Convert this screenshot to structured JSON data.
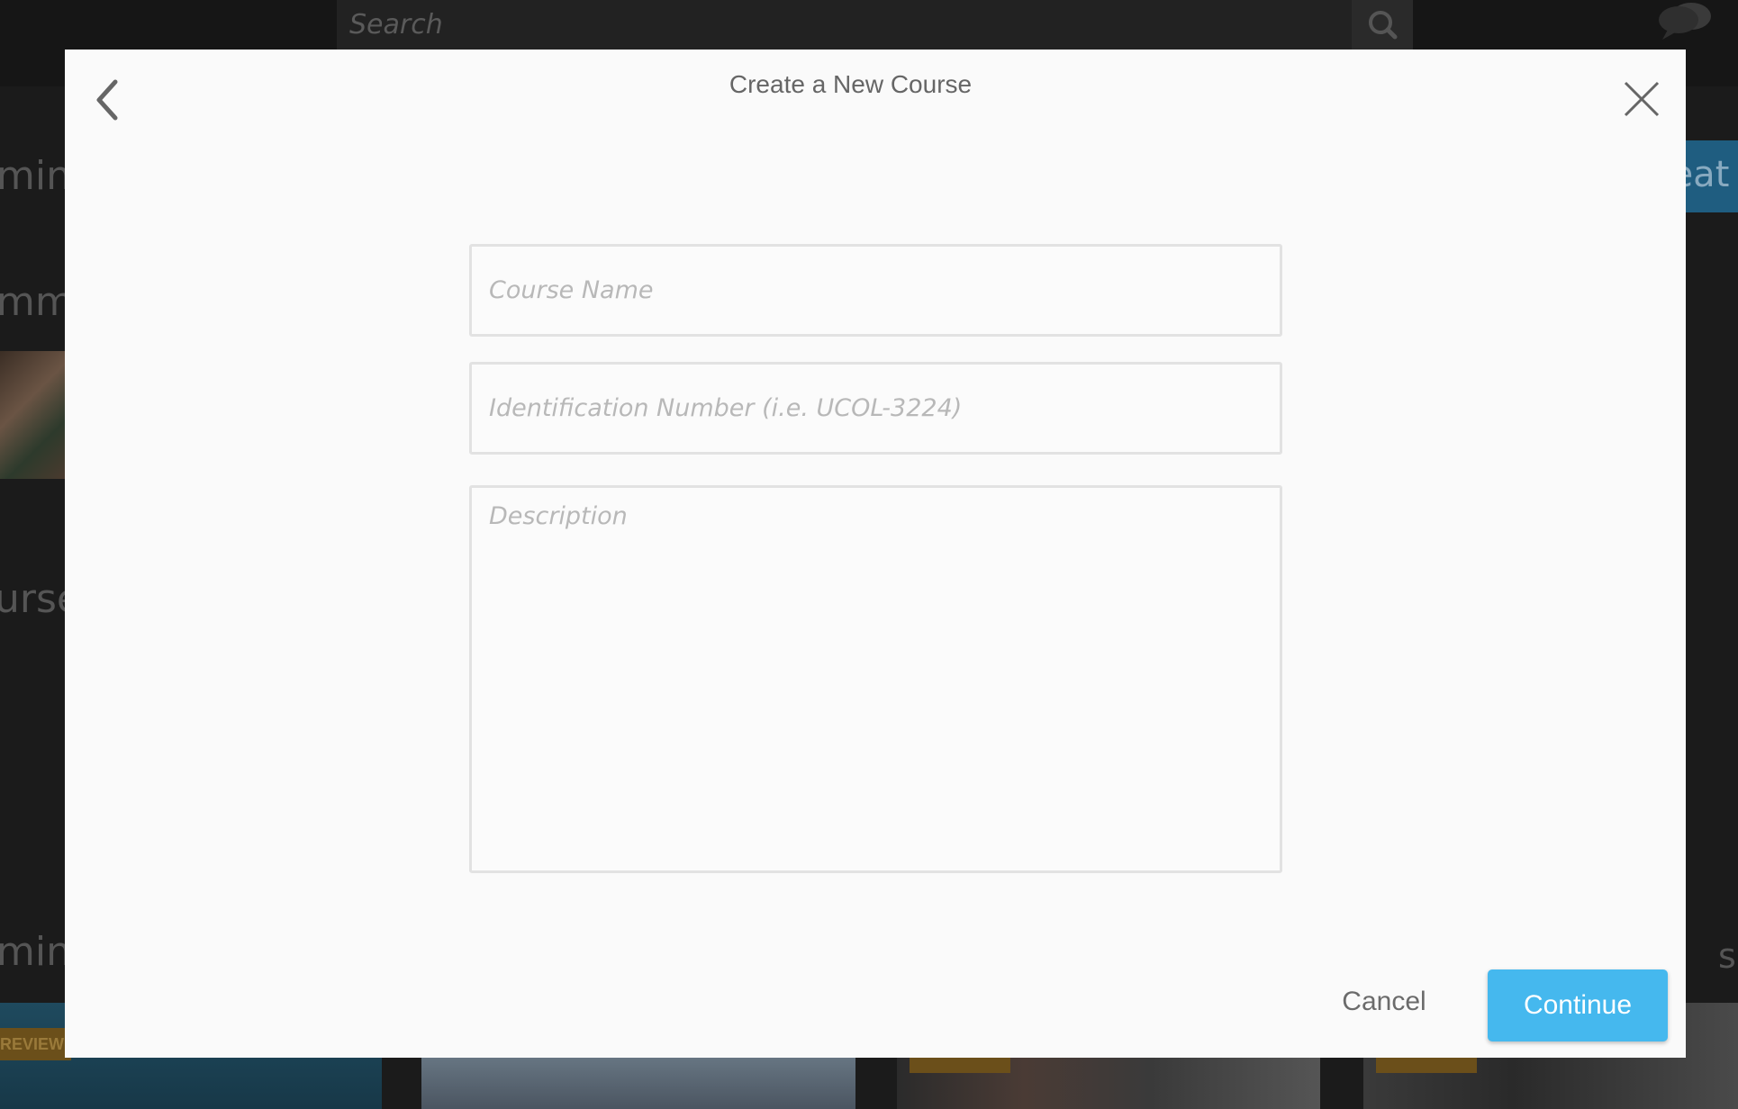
{
  "background": {
    "search": {
      "placeholder": "Search"
    },
    "side_fragments": {
      "line1": "mini",
      "line2": "mmu",
      "line3": "urse",
      "line4": "mini",
      "right_fragment": "s",
      "create_fragment": "reat"
    },
    "review_badge": "REVIEW",
    "icons": {
      "search": "search-icon",
      "chat": "chat-bubbles-icon"
    }
  },
  "modal": {
    "title": "Create a New Course",
    "icons": {
      "back": "chevron-left-icon",
      "close": "close-icon"
    },
    "form": {
      "course_name": {
        "placeholder": "Course Name",
        "value": ""
      },
      "identification_number": {
        "placeholder": "Identification Number (i.e. UCOL-3224)",
        "value": ""
      },
      "description": {
        "placeholder": "Description",
        "value": ""
      }
    },
    "actions": {
      "cancel_label": "Cancel",
      "continue_label": "Continue"
    }
  },
  "colors": {
    "accent": "#45b8ee",
    "overlay": "#1b1b1b",
    "modal_bg": "#fafafa"
  }
}
